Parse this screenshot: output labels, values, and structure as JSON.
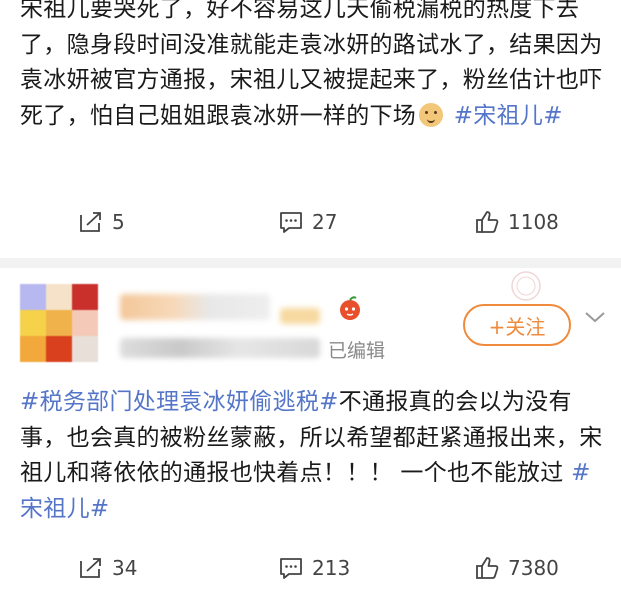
{
  "post1": {
    "text": "宋祖儿要哭死了，好不容易这几天偷税漏税的热度下去了，隐身段时间没准就能走袁冰妍的路试水了，结果因为袁冰妍被官方通报，宋祖儿又被提起来了，粉丝估计也吓死了，怕自己姐姐跟袁冰妍一样的下场",
    "emoji": "dog-face-emoji",
    "hashtag": "#宋祖儿#",
    "actions": {
      "repost": "5",
      "comment": "27",
      "like": "1108"
    }
  },
  "post2": {
    "author_meta": "已编辑",
    "follow_label": "+关注",
    "hashtag_lead": "#税务部门处理袁冰妍偷逃税#",
    "text": "不通报真的会以为没有事，也会真的被粉丝蒙蔽，所以希望都赶紧通报出来，宋祖儿和蒋依依的通报也快着点！！！ 一个也不能放过 ",
    "hashtag": "#宋祖儿#",
    "actions": {
      "repost": "34",
      "comment": "213",
      "like": "7380"
    }
  },
  "colors": {
    "link": "#5576c8",
    "follow": "#f08a3c",
    "icon": "#444444",
    "divider": "#f2f2f2"
  }
}
